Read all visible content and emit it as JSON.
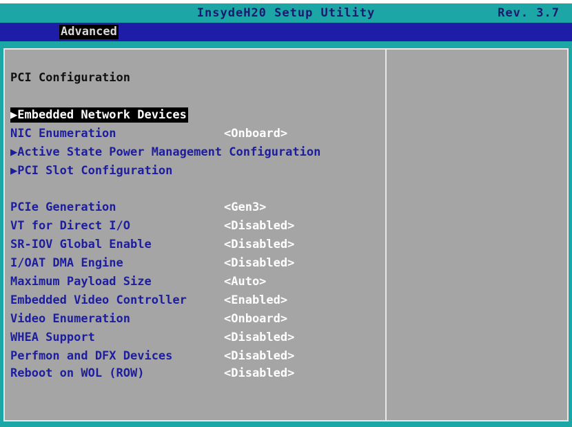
{
  "header": {
    "title": "InsydeH20 Setup Utility",
    "revision": "Rev. 3.7"
  },
  "menu": {
    "active_tab": "Advanced"
  },
  "page": {
    "section_title": "PCI Configuration",
    "submenus": [
      "▶Embedded Network Devices",
      "▶Active State Power Management Configuration",
      "▶PCI Slot Configuration"
    ],
    "nic_enumeration": {
      "label": "NIC Enumeration",
      "value": "<Onboard>"
    },
    "settings": [
      {
        "label": "PCIe Generation",
        "value": "<Gen3>"
      },
      {
        "label": "VT for Direct I/O",
        "value": "<Disabled>"
      },
      {
        "label": "SR-IOV Global Enable",
        "value": "<Disabled>"
      },
      {
        "label": "I/OAT DMA Engine",
        "value": "<Disabled>"
      },
      {
        "label": "Maximum Payload Size",
        "value": "<Auto>"
      },
      {
        "label": "Embedded Video Controller",
        "value": "<Enabled>"
      },
      {
        "label": "Video Enumeration",
        "value": "<Onboard>"
      },
      {
        "label": "WHEA Support",
        "value": "<Disabled>"
      },
      {
        "label": "Perfmon and DFX Devices",
        "value": "<Disabled>"
      },
      {
        "label": "Reboot on WOL (ROW)",
        "value": "<Disabled>"
      }
    ]
  },
  "colors": {
    "title_bar": "#1ca6a6",
    "menu_bar": "#1d1da8",
    "panel_bg": "#a5a5a5",
    "label_text": "#1d1d9e",
    "value_text": "#ffffff",
    "selection_bg": "#000000"
  }
}
